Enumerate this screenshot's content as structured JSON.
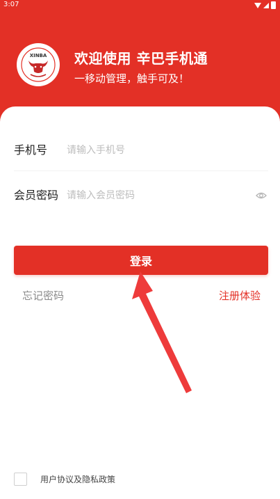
{
  "status_bar": {
    "time": "3:07"
  },
  "header": {
    "logo_text": "XINBA",
    "title": "欢迎使用 辛巴手机通",
    "subtitle": "一移动管理，触手可及！"
  },
  "form": {
    "phone": {
      "label": "手机号",
      "placeholder": "请输入手机号"
    },
    "password": {
      "label": "会员密码",
      "placeholder": "请输入会员密码",
      "toggle_icon": "eye-icon"
    }
  },
  "actions": {
    "login_label": "登录",
    "forgot_label": "忘记密码",
    "register_label": "注册体验"
  },
  "agreement": {
    "text": "用户协议及隐私政策",
    "checked": false
  },
  "colors": {
    "brand_red": "#e33026",
    "placeholder_gray": "#bdbdbd"
  }
}
